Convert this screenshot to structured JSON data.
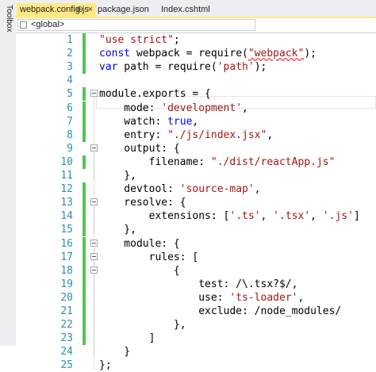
{
  "toolbox": {
    "label": "Toolbox"
  },
  "tabs": [
    {
      "label": "webpack.config.js",
      "pin": "⊕",
      "close": "×",
      "active": true
    },
    {
      "label": "package.json",
      "active": false
    },
    {
      "label": "Index.cshtml",
      "active": false
    }
  ],
  "navbar": {
    "scope": "<global>"
  },
  "editor": {
    "lines": [
      {
        "num": "1",
        "changed": true,
        "fold": false,
        "tokens": [
          [
            "s",
            "\"use strict\""
          ],
          [
            "t",
            ";"
          ]
        ]
      },
      {
        "num": "2",
        "changed": true,
        "fold": false,
        "tokens": [
          [
            "k",
            "const"
          ],
          [
            "t",
            " webpack = require("
          ],
          [
            "sq",
            "\"webpack\""
          ],
          [
            "t",
            ");"
          ]
        ]
      },
      {
        "num": "3",
        "changed": true,
        "fold": false,
        "tokens": [
          [
            "k",
            "var"
          ],
          [
            "t",
            " path = require("
          ],
          [
            "s",
            "'path'"
          ],
          [
            "t",
            ");"
          ]
        ]
      },
      {
        "num": "4",
        "changed": false,
        "fold": false,
        "tokens": []
      },
      {
        "num": "5",
        "changed": true,
        "fold": true,
        "tokens": [
          [
            "t",
            "module.exports = {"
          ]
        ]
      },
      {
        "num": "6",
        "changed": true,
        "fold": false,
        "tokens": [
          [
            "t",
            "    mode: "
          ],
          [
            "s",
            "'development'"
          ],
          [
            "t",
            ","
          ]
        ]
      },
      {
        "num": "7",
        "changed": true,
        "fold": false,
        "tokens": [
          [
            "t",
            "    watch: "
          ],
          [
            "k",
            "true"
          ],
          [
            "t",
            ","
          ]
        ]
      },
      {
        "num": "8",
        "changed": true,
        "fold": false,
        "tokens": [
          [
            "t",
            "    entry: "
          ],
          [
            "s",
            "\"./js/index.jsx\""
          ],
          [
            "t",
            ","
          ]
        ]
      },
      {
        "num": "9",
        "changed": false,
        "fold": true,
        "tokens": [
          [
            "t",
            "    output: {"
          ]
        ]
      },
      {
        "num": "10",
        "changed": true,
        "fold": false,
        "tokens": [
          [
            "t",
            "        filename: "
          ],
          [
            "s",
            "\"./dist/reactApp.js\""
          ]
        ]
      },
      {
        "num": "11",
        "changed": false,
        "fold": false,
        "tokens": [
          [
            "t",
            "    },"
          ]
        ]
      },
      {
        "num": "12",
        "changed": true,
        "fold": false,
        "tokens": [
          [
            "t",
            "    devtool: "
          ],
          [
            "s",
            "'source-map'"
          ],
          [
            "t",
            ","
          ]
        ]
      },
      {
        "num": "13",
        "changed": true,
        "fold": true,
        "tokens": [
          [
            "t",
            "    resolve: {"
          ]
        ]
      },
      {
        "num": "14",
        "changed": true,
        "fold": false,
        "tokens": [
          [
            "t",
            "        extensions: ["
          ],
          [
            "s",
            "'.ts'"
          ],
          [
            "t",
            ", "
          ],
          [
            "s",
            "'.tsx'"
          ],
          [
            "t",
            ", "
          ],
          [
            "s",
            "'.js'"
          ],
          [
            "t",
            "]"
          ]
        ]
      },
      {
        "num": "15",
        "changed": true,
        "fold": false,
        "tokens": [
          [
            "t",
            "    },"
          ]
        ]
      },
      {
        "num": "16",
        "changed": true,
        "fold": true,
        "tokens": [
          [
            "t",
            "    module: {"
          ]
        ]
      },
      {
        "num": "17",
        "changed": true,
        "fold": true,
        "tokens": [
          [
            "t",
            "        rules: ["
          ]
        ]
      },
      {
        "num": "18",
        "changed": true,
        "fold": true,
        "tokens": [
          [
            "t",
            "            {"
          ]
        ]
      },
      {
        "num": "19",
        "changed": true,
        "fold": false,
        "tokens": [
          [
            "t",
            "                test: /\\.tsx?$/,"
          ]
        ]
      },
      {
        "num": "20",
        "changed": true,
        "fold": false,
        "tokens": [
          [
            "t",
            "                use: "
          ],
          [
            "s",
            "'ts-loader'"
          ],
          [
            "t",
            ","
          ]
        ]
      },
      {
        "num": "21",
        "changed": true,
        "fold": false,
        "tokens": [
          [
            "t",
            "                exclude: /node_modules/"
          ]
        ]
      },
      {
        "num": "22",
        "changed": true,
        "fold": false,
        "tokens": [
          [
            "t",
            "            },"
          ]
        ]
      },
      {
        "num": "23",
        "changed": true,
        "fold": false,
        "tokens": [
          [
            "t",
            "        ]"
          ]
        ]
      },
      {
        "num": "24",
        "changed": false,
        "fold": false,
        "tokens": [
          [
            "t",
            "    }"
          ]
        ]
      },
      {
        "num": "25",
        "changed": false,
        "fold": false,
        "tokens": [
          [
            "t",
            "};"
          ]
        ]
      }
    ]
  }
}
